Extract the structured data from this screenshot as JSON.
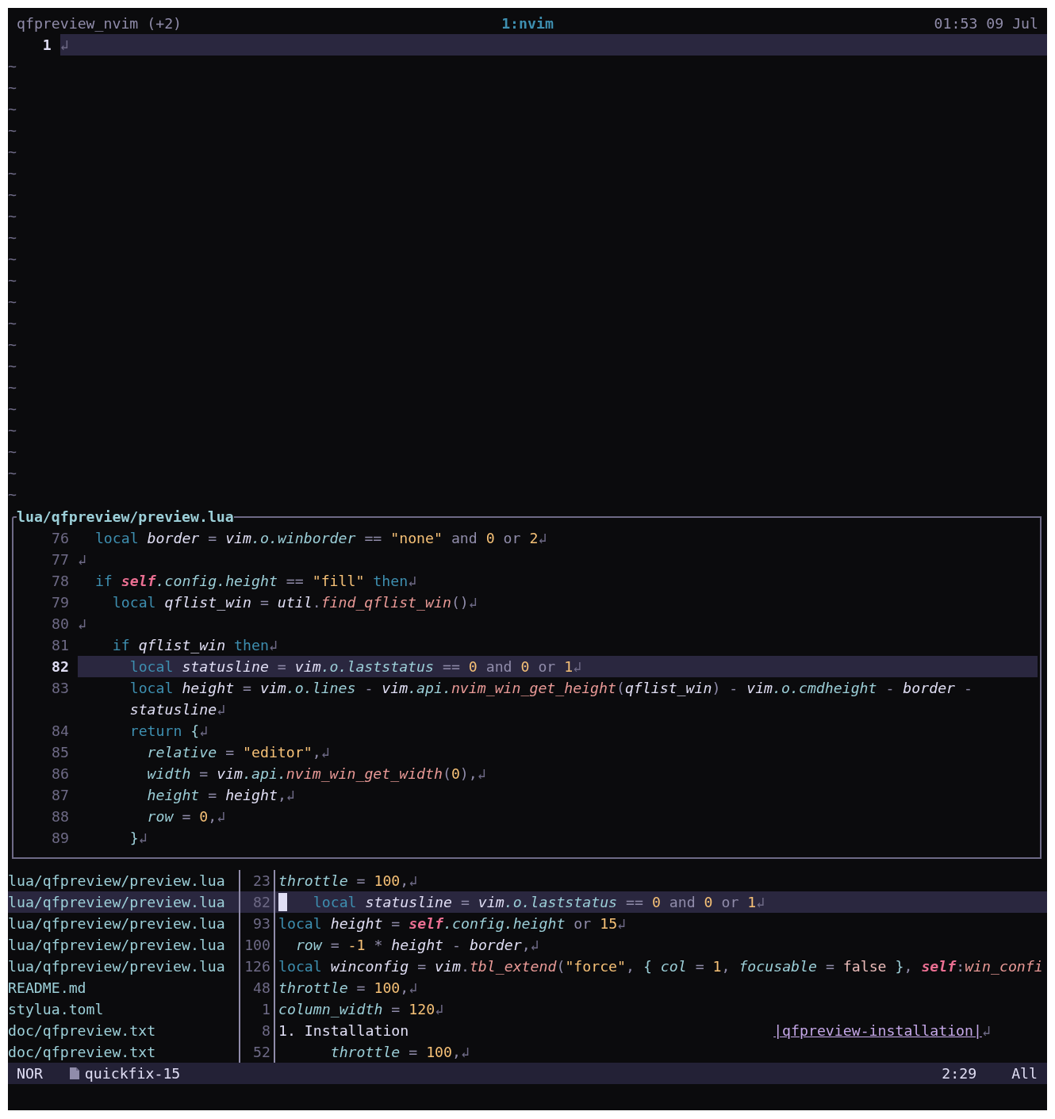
{
  "tmux_bar": {
    "session": "qfpreview_nvim (+2)",
    "window": "1:nvim",
    "clock": "01:53 09 Jul"
  },
  "main_window": {
    "lines": [
      {
        "number": "1",
        "current": true,
        "tokens": [
          {
            "kind": "eol",
            "text": "↲"
          }
        ]
      }
    ],
    "filler": [
      "~",
      "~",
      "~",
      "~",
      "~",
      "~",
      "~",
      "~",
      "~",
      "~",
      "~",
      "~",
      "~",
      "~",
      "~",
      "~",
      "~",
      "~",
      "~",
      "~",
      "~"
    ]
  },
  "preview": {
    "title": "lua/qfpreview/preview.lua",
    "lines": [
      {
        "number": "76",
        "current": false,
        "tokens": [
          {
            "kind": "kw",
            "text": "  local"
          },
          {
            "kind": "var",
            "text": " border"
          },
          {
            "kind": "op",
            "text": " ="
          },
          {
            "kind": "var",
            "text": " vim"
          },
          {
            "kind": "prop",
            "text": ".o.winborder"
          },
          {
            "kind": "op",
            "text": " =="
          },
          {
            "kind": "str",
            "text": " \"none\""
          },
          {
            "kind": "logic",
            "text": " and"
          },
          {
            "kind": "num",
            "text": " 0"
          },
          {
            "kind": "logic",
            "text": " or"
          },
          {
            "kind": "num",
            "text": " 2"
          },
          {
            "kind": "eol",
            "text": "↲"
          }
        ]
      },
      {
        "number": "77",
        "current": false,
        "tokens": [
          {
            "kind": "eol",
            "text": "↲"
          }
        ]
      },
      {
        "number": "78",
        "current": false,
        "tokens": [
          {
            "kind": "kw",
            "text": "  if"
          },
          {
            "kind": "self",
            "text": " self"
          },
          {
            "kind": "prop",
            "text": ".config.height"
          },
          {
            "kind": "op",
            "text": " =="
          },
          {
            "kind": "str",
            "text": " \"fill\""
          },
          {
            "kind": "kw",
            "text": " then"
          },
          {
            "kind": "eol",
            "text": "↲"
          }
        ]
      },
      {
        "number": "79",
        "current": false,
        "tokens": [
          {
            "kind": "kw",
            "text": "    local"
          },
          {
            "kind": "var",
            "text": " qflist_win"
          },
          {
            "kind": "op",
            "text": " ="
          },
          {
            "kind": "var",
            "text": " util"
          },
          {
            "kind": "op",
            "text": "."
          },
          {
            "kind": "fn",
            "text": "find_qflist_win"
          },
          {
            "kind": "op",
            "text": "()"
          },
          {
            "kind": "eol",
            "text": "↲"
          }
        ]
      },
      {
        "number": "80",
        "current": false,
        "tokens": [
          {
            "kind": "eol",
            "text": "↲"
          }
        ]
      },
      {
        "number": "81",
        "current": false,
        "tokens": [
          {
            "kind": "kw",
            "text": "    if"
          },
          {
            "kind": "var",
            "text": " qflist_win"
          },
          {
            "kind": "kw",
            "text": " then"
          },
          {
            "kind": "eol",
            "text": "↲"
          }
        ]
      },
      {
        "number": "82",
        "current": true,
        "tokens": [
          {
            "kind": "kw",
            "text": "      local"
          },
          {
            "kind": "var",
            "text": " statusline"
          },
          {
            "kind": "op",
            "text": " ="
          },
          {
            "kind": "var",
            "text": " vim"
          },
          {
            "kind": "prop",
            "text": ".o.laststatus"
          },
          {
            "kind": "op",
            "text": " =="
          },
          {
            "kind": "num",
            "text": " 0"
          },
          {
            "kind": "logic",
            "text": " and"
          },
          {
            "kind": "num",
            "text": " 0"
          },
          {
            "kind": "logic",
            "text": " or"
          },
          {
            "kind": "num",
            "text": " 1"
          },
          {
            "kind": "eol",
            "text": "↲"
          }
        ]
      },
      {
        "number": "83",
        "current": false,
        "tokens": [
          {
            "kind": "kw",
            "text": "      local"
          },
          {
            "kind": "var",
            "text": " height"
          },
          {
            "kind": "op",
            "text": " ="
          },
          {
            "kind": "var",
            "text": " vim"
          },
          {
            "kind": "prop",
            "text": ".o.lines"
          },
          {
            "kind": "op",
            "text": " -"
          },
          {
            "kind": "var",
            "text": " vim"
          },
          {
            "kind": "prop",
            "text": ".api."
          },
          {
            "kind": "fn",
            "text": "nvim_win_get_height"
          },
          {
            "kind": "op",
            "text": "("
          },
          {
            "kind": "var",
            "text": "qflist_win"
          },
          {
            "kind": "op",
            "text": ")"
          },
          {
            "kind": "op",
            "text": " -"
          },
          {
            "kind": "var",
            "text": " vim"
          },
          {
            "kind": "prop",
            "text": ".o.cmdheight"
          },
          {
            "kind": "op",
            "text": " -"
          },
          {
            "kind": "var",
            "text": " border"
          },
          {
            "kind": "op",
            "text": " -"
          }
        ],
        "continuation": [
          {
            "kind": "var",
            "text": "      statusline"
          },
          {
            "kind": "eol",
            "text": "↲"
          }
        ]
      },
      {
        "number": "84",
        "current": false,
        "tokens": [
          {
            "kind": "kw",
            "text": "      return"
          },
          {
            "kind": "brace",
            "text": " {"
          },
          {
            "kind": "eol",
            "text": "↲"
          }
        ]
      },
      {
        "number": "85",
        "current": false,
        "tokens": [
          {
            "kind": "prop",
            "text": "        relative"
          },
          {
            "kind": "op",
            "text": " ="
          },
          {
            "kind": "str",
            "text": " \"editor\""
          },
          {
            "kind": "op",
            "text": ","
          },
          {
            "kind": "eol",
            "text": "↲"
          }
        ]
      },
      {
        "number": "86",
        "current": false,
        "tokens": [
          {
            "kind": "prop",
            "text": "        width"
          },
          {
            "kind": "op",
            "text": " ="
          },
          {
            "kind": "var",
            "text": " vim"
          },
          {
            "kind": "prop",
            "text": ".api."
          },
          {
            "kind": "fn",
            "text": "nvim_win_get_width"
          },
          {
            "kind": "op",
            "text": "("
          },
          {
            "kind": "num",
            "text": "0"
          },
          {
            "kind": "op",
            "text": "),"
          },
          {
            "kind": "eol",
            "text": "↲"
          }
        ]
      },
      {
        "number": "87",
        "current": false,
        "tokens": [
          {
            "kind": "prop",
            "text": "        height"
          },
          {
            "kind": "op",
            "text": " ="
          },
          {
            "kind": "var",
            "text": " height"
          },
          {
            "kind": "op",
            "text": ","
          },
          {
            "kind": "eol",
            "text": "↲"
          }
        ]
      },
      {
        "number": "88",
        "current": false,
        "tokens": [
          {
            "kind": "prop",
            "text": "        row"
          },
          {
            "kind": "op",
            "text": " ="
          },
          {
            "kind": "num",
            "text": " 0"
          },
          {
            "kind": "op",
            "text": ","
          },
          {
            "kind": "eol",
            "text": "↲"
          }
        ]
      },
      {
        "number": "89",
        "current": false,
        "tokens": [
          {
            "kind": "brace",
            "text": "      }"
          },
          {
            "kind": "eol",
            "text": "↲"
          }
        ]
      }
    ]
  },
  "quickfix": {
    "items": [
      {
        "file": "lua/qfpreview/preview.lua",
        "line": "23",
        "selected": false,
        "tokens": [
          {
            "kind": "prop",
            "text": "throttle"
          },
          {
            "kind": "op",
            "text": " ="
          },
          {
            "kind": "num",
            "text": " 100"
          },
          {
            "kind": "op",
            "text": ","
          },
          {
            "kind": "eol",
            "text": "↲"
          }
        ]
      },
      {
        "file": "lua/qfpreview/preview.lua",
        "line": "82",
        "selected": true,
        "tokens": [
          {
            "kind": "kw",
            "text": "   local"
          },
          {
            "kind": "var",
            "text": " statusline"
          },
          {
            "kind": "op",
            "text": " ="
          },
          {
            "kind": "var",
            "text": " vim"
          },
          {
            "kind": "prop",
            "text": ".o.laststatus"
          },
          {
            "kind": "op",
            "text": " =="
          },
          {
            "kind": "num",
            "text": " 0"
          },
          {
            "kind": "logic",
            "text": " and"
          },
          {
            "kind": "num",
            "text": " 0"
          },
          {
            "kind": "logic",
            "text": " or"
          },
          {
            "kind": "num",
            "text": " 1"
          },
          {
            "kind": "eol",
            "text": "↲"
          }
        ]
      },
      {
        "file": "lua/qfpreview/preview.lua",
        "line": "93",
        "selected": false,
        "tokens": [
          {
            "kind": "kw",
            "text": "local"
          },
          {
            "kind": "var",
            "text": " height"
          },
          {
            "kind": "op",
            "text": " ="
          },
          {
            "kind": "self",
            "text": " self"
          },
          {
            "kind": "prop",
            "text": ".config.height"
          },
          {
            "kind": "logic",
            "text": " or"
          },
          {
            "kind": "num",
            "text": " 15"
          },
          {
            "kind": "eol",
            "text": "↲"
          }
        ]
      },
      {
        "file": "lua/qfpreview/preview.lua",
        "line": "100",
        "selected": false,
        "tokens": [
          {
            "kind": "prop",
            "text": "  row"
          },
          {
            "kind": "op",
            "text": " ="
          },
          {
            "kind": "num",
            "text": " -1"
          },
          {
            "kind": "op",
            "text": " *"
          },
          {
            "kind": "var",
            "text": " height"
          },
          {
            "kind": "op",
            "text": " -"
          },
          {
            "kind": "var",
            "text": " border"
          },
          {
            "kind": "op",
            "text": ","
          },
          {
            "kind": "eol",
            "text": "↲"
          }
        ]
      },
      {
        "file": "lua/qfpreview/preview.lua",
        "line": "126",
        "selected": false,
        "tokens": [
          {
            "kind": "kw",
            "text": "local"
          },
          {
            "kind": "var",
            "text": " winconfig"
          },
          {
            "kind": "op",
            "text": " ="
          },
          {
            "kind": "var",
            "text": " vim"
          },
          {
            "kind": "op",
            "text": "."
          },
          {
            "kind": "fn",
            "text": "tbl_extend"
          },
          {
            "kind": "op",
            "text": "("
          },
          {
            "kind": "str",
            "text": "\"force\""
          },
          {
            "kind": "op",
            "text": ","
          },
          {
            "kind": "brace",
            "text": " {"
          },
          {
            "kind": "prop",
            "text": " col"
          },
          {
            "kind": "op",
            "text": " ="
          },
          {
            "kind": "num",
            "text": " 1"
          },
          {
            "kind": "op",
            "text": ","
          },
          {
            "kind": "prop",
            "text": " focusable"
          },
          {
            "kind": "op",
            "text": " ="
          },
          {
            "kind": "const",
            "text": " false"
          },
          {
            "kind": "brace",
            "text": " }"
          },
          {
            "kind": "op",
            "text": ","
          },
          {
            "kind": "self",
            "text": " self"
          },
          {
            "kind": "op",
            "text": ":"
          },
          {
            "kind": "fn",
            "text": "win_confi"
          }
        ]
      },
      {
        "file": "README.md",
        "line": "48",
        "selected": false,
        "tokens": [
          {
            "kind": "prop",
            "text": "throttle"
          },
          {
            "kind": "op",
            "text": " ="
          },
          {
            "kind": "num",
            "text": " 100"
          },
          {
            "kind": "op",
            "text": ","
          },
          {
            "kind": "eol",
            "text": "↲"
          }
        ]
      },
      {
        "file": "stylua.toml",
        "line": "1",
        "selected": false,
        "tokens": [
          {
            "kind": "prop",
            "text": "column_width"
          },
          {
            "kind": "op",
            "text": " ="
          },
          {
            "kind": "num",
            "text": " 120"
          },
          {
            "kind": "eol",
            "text": "↲"
          }
        ]
      },
      {
        "file": "doc/qfpreview.txt",
        "line": "8",
        "selected": false,
        "tokens": [
          {
            "kind": "text",
            "text": "1. Installation                                          "
          },
          {
            "kind": "link",
            "text": "|qfpreview-installation|"
          },
          {
            "kind": "eol",
            "text": "↲"
          }
        ]
      },
      {
        "file": "doc/qfpreview.txt",
        "line": "52",
        "selected": false,
        "tokens": [
          {
            "kind": "prop",
            "text": "      throttle"
          },
          {
            "kind": "op",
            "text": " ="
          },
          {
            "kind": "num",
            "text": " 100"
          },
          {
            "kind": "op",
            "text": ","
          },
          {
            "kind": "eol",
            "text": "↲"
          }
        ]
      }
    ]
  },
  "status_line": {
    "mode": "NOR",
    "buffer": "quickfix-15",
    "position": "2:29",
    "scroll": "All"
  }
}
